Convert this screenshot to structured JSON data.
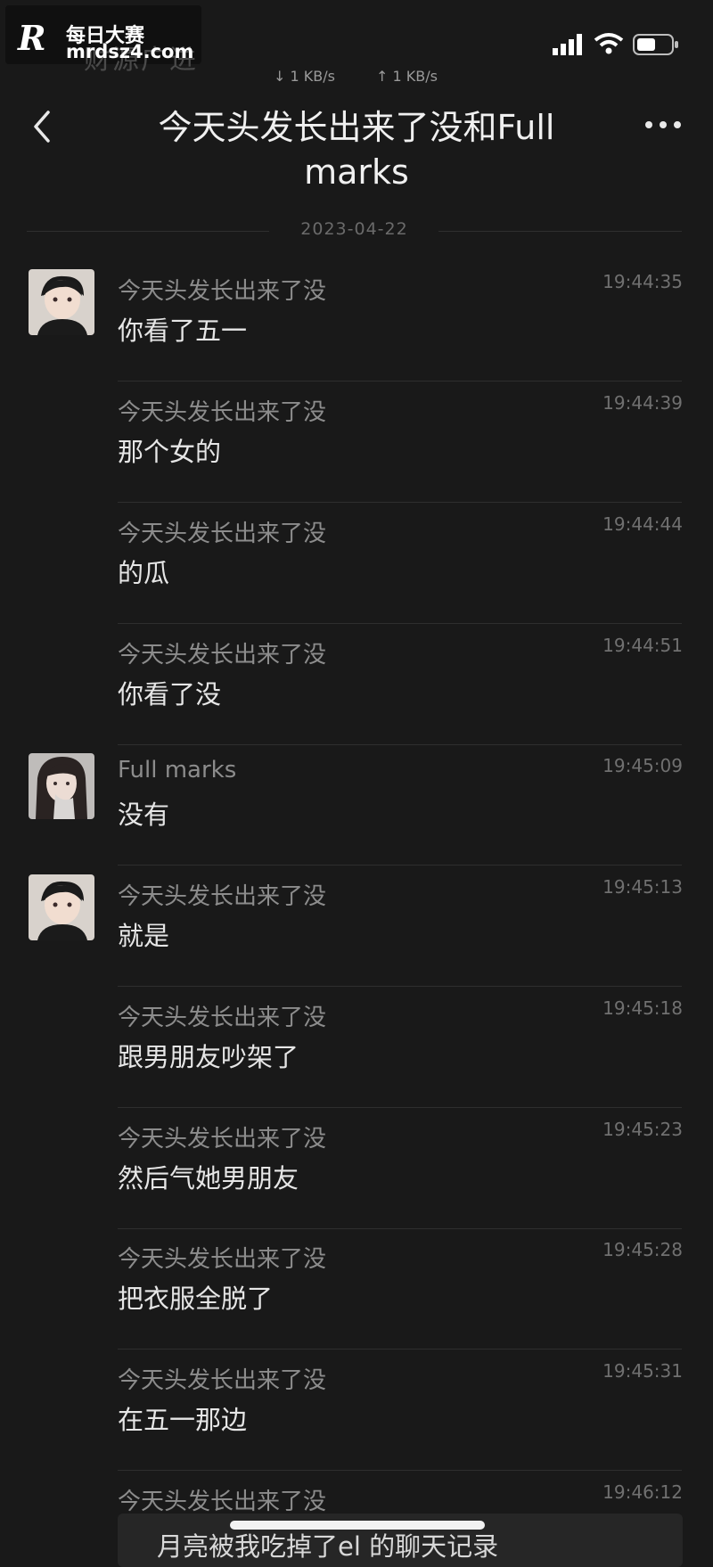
{
  "watermark": {
    "logo": "R",
    "title": "每日大赛",
    "site": "mrdsz4.com",
    "under_text": "财源广进"
  },
  "status_bar": {
    "download": "↓ 1 KB/s",
    "upload": "↑ 1 KB/s"
  },
  "header": {
    "title": "今天头发长出来了没和Full marks"
  },
  "date_divider": "2023-04-22",
  "messages": [
    {
      "sender": "今天头发长出来了没",
      "time": "19:44:35",
      "text": "你看了五一"
    },
    {
      "sender": "今天头发长出来了没",
      "time": "19:44:39",
      "text": "那个女的"
    },
    {
      "sender": "今天头发长出来了没",
      "time": "19:44:44",
      "text": "的瓜"
    },
    {
      "sender": "今天头发长出来了没",
      "time": "19:44:51",
      "text": "你看了没"
    },
    {
      "sender": "Full marks",
      "time": "19:45:09",
      "text": "没有"
    },
    {
      "sender": "今天头发长出来了没",
      "time": "19:45:13",
      "text": "就是"
    },
    {
      "sender": "今天头发长出来了没",
      "time": "19:45:18",
      "text": "跟男朋友吵架了"
    },
    {
      "sender": "今天头发长出来了没",
      "time": "19:45:23",
      "text": "然后气她男朋友"
    },
    {
      "sender": "今天头发长出来了没",
      "time": "19:45:28",
      "text": "把衣服全脱了"
    },
    {
      "sender": "今天头发长出来了没",
      "time": "19:45:31",
      "text": "在五一那边"
    },
    {
      "sender": "今天头发长出来了没",
      "time": "19:46:12",
      "text": ""
    }
  ],
  "quote_card": {
    "text": "月亮被我吃掉了el 的聊天记录"
  },
  "colors": {
    "background": "#191919",
    "text_primary": "#e6e6e6",
    "text_secondary": "#8c8c8c"
  }
}
